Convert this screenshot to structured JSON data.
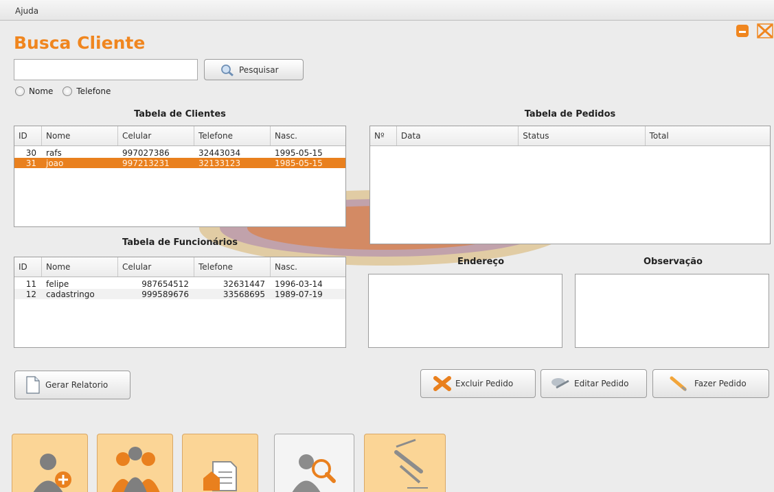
{
  "menu": {
    "help_label": "Ajuda"
  },
  "page": {
    "title": "Busca Cliente"
  },
  "search": {
    "value": "",
    "button_label": "Pesquisar",
    "radio_options": [
      "Nome",
      "Telefone"
    ]
  },
  "clients_table": {
    "title": "Tabela de Clientes",
    "columns": [
      "ID",
      "Nome",
      "Celular",
      "Telefone",
      "Nasc."
    ],
    "rows": [
      [
        "30",
        "rafs",
        "997027386",
        "32443034",
        "1995-05-15"
      ],
      [
        "31",
        "joao",
        "997213231",
        "32133123",
        "1985-05-15"
      ]
    ],
    "selected_row": 1
  },
  "employees_table": {
    "title": "Tabela de Funcionários",
    "columns": [
      "ID",
      "Nome",
      "Celular",
      "Telefone",
      "Nasc."
    ],
    "rows": [
      [
        "11",
        "felipe",
        "987654512",
        "32631447",
        "1996-03-14"
      ],
      [
        "12",
        "cadastringo",
        "999589676",
        "33568695",
        "1989-07-19"
      ]
    ]
  },
  "orders_table": {
    "title": "Tabela de Pedidos",
    "columns": [
      "Nº",
      "Data",
      "Status",
      "Total"
    ],
    "rows": []
  },
  "address": {
    "label": "Endereço",
    "value": ""
  },
  "notes": {
    "label": "Observação",
    "value": ""
  },
  "actions": {
    "report_label": "Gerar Relatorio",
    "delete_label": "Excluir Pedido",
    "edit_label": "Editar Pedido",
    "make_label": "Fazer Pedido"
  },
  "nav": {
    "items": [
      {
        "icon": "add-user-icon",
        "active": false
      },
      {
        "icon": "users-group-icon",
        "active": false
      },
      {
        "icon": "user-card-icon",
        "active": false
      },
      {
        "icon": "search-user-icon",
        "active": true
      },
      {
        "icon": "edit-pencil-icon",
        "active": false
      }
    ]
  },
  "colors": {
    "accent": "#f0861f",
    "selected_row": "#e9801e",
    "nav_bg": "#fbd596"
  }
}
